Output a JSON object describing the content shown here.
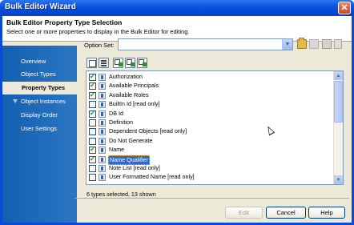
{
  "window": {
    "title": "Bulk Editor Wizard",
    "close_glyph": "✕"
  },
  "header": {
    "title": "Bulk Editor Property Type Selection",
    "subtitle": "Select one or more properties to display in the Bulk Editor for editing."
  },
  "nav": {
    "items": [
      {
        "label": "Overview",
        "active": false
      },
      {
        "label": "Object Types",
        "active": false
      },
      {
        "label": "Property Types",
        "active": true
      },
      {
        "label": "Object Instances",
        "active": false
      },
      {
        "label": "Display Order",
        "active": false
      },
      {
        "label": "User Settings",
        "active": false
      }
    ]
  },
  "option_set": {
    "label": "Option Set:",
    "value": "",
    "dropdown_glyph": "▼"
  },
  "toolbar_icons": [
    "open-folder-icon",
    "save-icon",
    "save-as-icon",
    "delete-icon"
  ],
  "list_tools": [
    "select-all-icon",
    "properties-icon",
    "check-icon",
    "uncheck-icon",
    "filter-icon"
  ],
  "properties": [
    {
      "label": "Authorization",
      "checked": true,
      "selected": false
    },
    {
      "label": "Available Principals",
      "checked": true,
      "selected": false
    },
    {
      "label": "Available Roles",
      "checked": true,
      "selected": false
    },
    {
      "label": "BuiltIn Id [read only]",
      "checked": false,
      "selected": false
    },
    {
      "label": "DB Id",
      "checked": true,
      "selected": false
    },
    {
      "label": "Definition",
      "checked": false,
      "selected": false
    },
    {
      "label": "Dependent Objects [read only]",
      "checked": false,
      "selected": false
    },
    {
      "label": "Do Not Generate",
      "checked": false,
      "selected": false
    },
    {
      "label": "Name",
      "checked": true,
      "selected": false
    },
    {
      "label": "Name Qualifier",
      "checked": true,
      "selected": true
    },
    {
      "label": "Note List [read only]",
      "checked": false,
      "selected": false
    },
    {
      "label": "User Formatted Name [read only]",
      "checked": false,
      "selected": false
    }
  ],
  "scrollbar": {
    "up_glyph": "▲",
    "down_glyph": "▼"
  },
  "status": "6 types selected, 13 shown",
  "buttons": {
    "edit": "Edit",
    "cancel": "Cancel",
    "help": "Help"
  },
  "colors": {
    "title_bar": "#0b54e3",
    "nav_bg": "#1e68b3",
    "selection": "#316ac5",
    "dialog_bg": "#ece9d8"
  }
}
